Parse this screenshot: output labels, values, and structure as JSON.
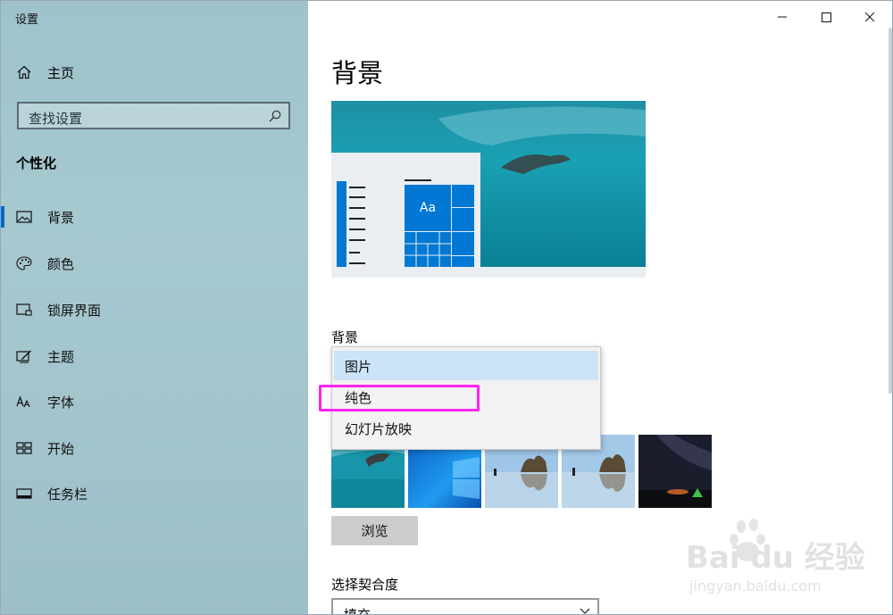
{
  "app": {
    "title": "设置"
  },
  "sidebar": {
    "home_label": "主页",
    "search_placeholder": "查找设置",
    "section_title": "个性化",
    "items": [
      {
        "label": "背景",
        "icon": "picture-icon",
        "active": true
      },
      {
        "label": "颜色",
        "icon": "palette-icon",
        "active": false
      },
      {
        "label": "锁屏界面",
        "icon": "lock-screen-icon",
        "active": false
      },
      {
        "label": "主题",
        "icon": "theme-pen-icon",
        "active": false
      },
      {
        "label": "字体",
        "icon": "font-icon",
        "active": false
      },
      {
        "label": "开始",
        "icon": "start-grid-icon",
        "active": false
      },
      {
        "label": "任务栏",
        "icon": "taskbar-icon",
        "active": false
      }
    ]
  },
  "content": {
    "page_title": "背景",
    "preview_tile_text": "Aa",
    "background_label": "背景",
    "dropdown_options": [
      "图片",
      "纯色",
      "幻灯片放映"
    ],
    "selected_option": "图片",
    "browse_label": "浏览",
    "fit_label": "选择契合度",
    "fit_value": "填充"
  },
  "watermark": {
    "logo_text": "Bai du 经验",
    "url": "jingyan.baidu.com"
  },
  "colors": {
    "accent": "#0066cc",
    "highlight": "#ff22ee",
    "selected_bg": "#cce4f7",
    "sidebar_bg": "#a3c4cc"
  }
}
